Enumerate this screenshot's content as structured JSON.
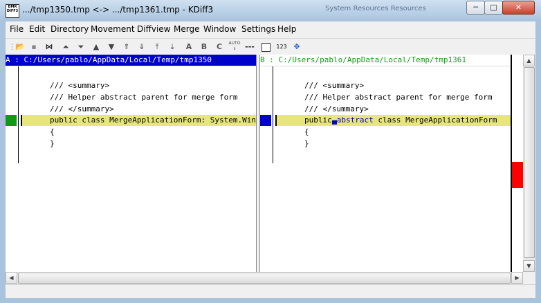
{
  "window": {
    "title": ".../tmp1350.tmp <-> .../tmp1361.tmp - KDiff3",
    "app_icon_text": "BMR DIFF3",
    "background_title": "System Resources Resources",
    "min_glyph": "─",
    "max_glyph": "□",
    "close_glyph": "✕"
  },
  "menu": [
    "File",
    "Edit",
    "Directory",
    "Movement",
    "Diffview",
    "Merge",
    "Window",
    "Settings",
    "Help"
  ],
  "toolbar": {
    "icons": [
      "open-folder-icon",
      "save-icon",
      "merge-icon",
      "go-top-icon",
      "go-bottom-icon",
      "prev-delta-icon",
      "next-delta-icon",
      "prev-conflict-icon",
      "next-conflict-icon",
      "prev-unsolved-icon",
      "next-unsolved-icon",
      "choose-a-icon",
      "choose-b-icon",
      "choose-c-icon",
      "auto-advance-icon",
      "show-whitespace-icon",
      "show-line-numbers-icon",
      "wordwrap-icon"
    ],
    "choose_a": "A",
    "choose_b": "B",
    "choose_c": "C",
    "auto_label": "AUTO",
    "whitespace_label": "---",
    "line_numbers_label": "123"
  },
  "pane_a": {
    "header": "A : C:/Users/pablo/AppData/Local/Temp/tmp1350",
    "lines": [
      "",
      "/// <summary>",
      "/// Helper abstract parent for merge form",
      "/// </summary>",
      "public class MergeApplicationForm: System.Windows.Forms.Form",
      "{",
      "}"
    ]
  },
  "pane_b": {
    "header": "B : C:/Users/pablo/AppData/Local/Temp/tmp1361",
    "lines": [
      "",
      "/// <summary>",
      "/// Helper abstract parent for merge form",
      "/// </summary>",
      "",
      "{",
      "}"
    ],
    "diff_line": {
      "prefix": "public",
      "inserted": "abstract",
      "suffix": " class MergeApplicationForm"
    }
  },
  "colors": {
    "header_a_bg": "#0000cc",
    "header_b_text": "#11a011",
    "changed_line_bg": "#e6e67a",
    "marker_a": "#119911",
    "marker_b": "#0000cc",
    "overview_conflict": "#ff0000"
  }
}
